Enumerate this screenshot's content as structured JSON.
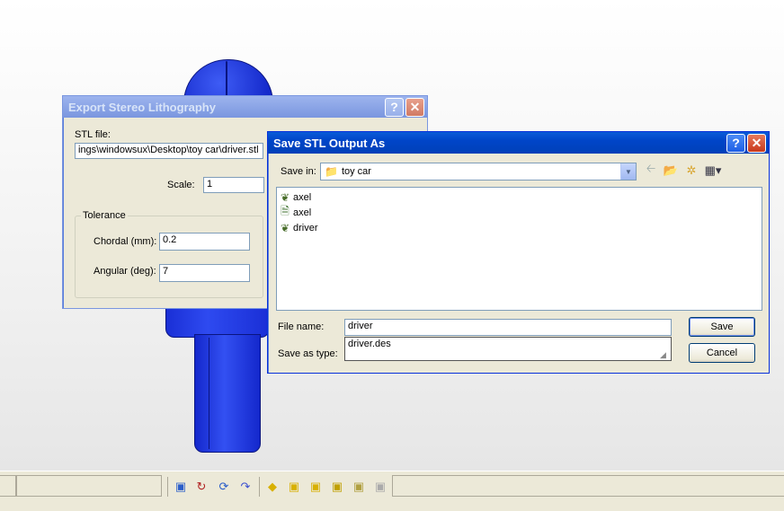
{
  "export_dialog": {
    "title": "Export Stereo Lithography",
    "stl_label": "STL file:",
    "stl_value": "ings\\windowsux\\Desktop\\toy car\\driver.stl",
    "scale_label": "Scale:",
    "scale_value": "1",
    "tolerance_label": "Tolerance",
    "chordal_label": "Chordal (mm):",
    "chordal_value": "0.2",
    "angular_label": "Angular (deg):",
    "angular_value": "7",
    "help_glyph": "?",
    "close_glyph": "✕"
  },
  "save_dialog": {
    "title": "Save STL Output As",
    "save_in_label": "Save in:",
    "save_in_value": "toy car",
    "files": [
      {
        "name": "axel",
        "icon": "part-icon"
      },
      {
        "name": "axel",
        "icon": "notepad-icon"
      },
      {
        "name": "driver",
        "icon": "part-icon"
      }
    ],
    "file_name_label": "File name:",
    "file_name_value": "driver",
    "save_as_type_label": "Save as type:",
    "save_as_type_value": "driver.des",
    "save_button": "Save",
    "cancel_button": "Cancel",
    "help_glyph": "?",
    "close_glyph": "✕"
  },
  "colors": {
    "active_title": "#0045c8",
    "model_blue": "#1a2fd6"
  }
}
